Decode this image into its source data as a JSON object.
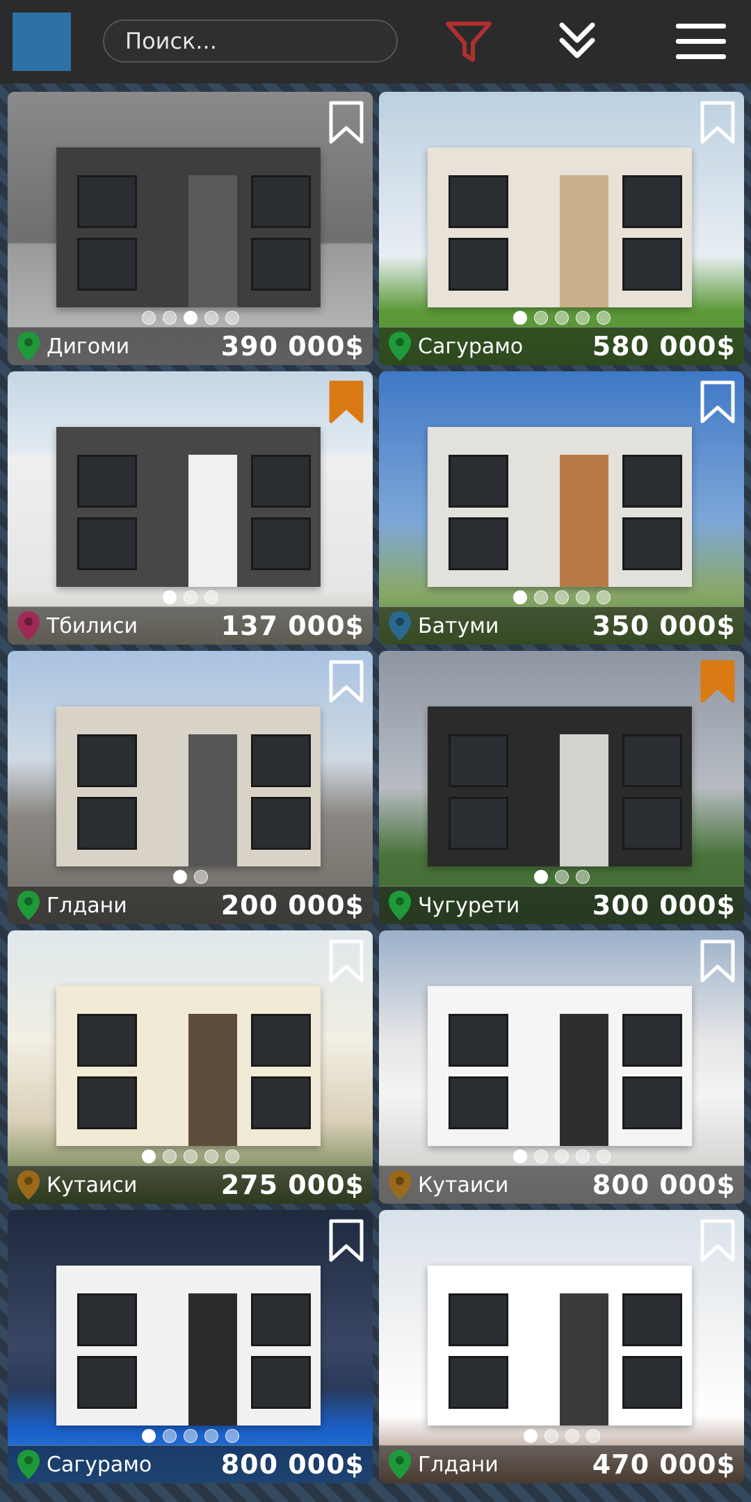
{
  "search": {
    "placeholder": "Поиск..."
  },
  "colors": {
    "accent_blue": "#2d72a6",
    "filter_red": "#b03030",
    "bookmark_saved": "#d97a12",
    "pin_green": "#1f9a3b",
    "pin_crimson": "#a02a56",
    "pin_blue": "#2a6a90",
    "pin_bronze": "#9a6a1a"
  },
  "icons": {
    "filter": "filter-icon",
    "collapse": "double-chevron-down-icon",
    "menu": "hamburger-menu-icon",
    "bookmark": "bookmark-icon",
    "location": "location-pin-icon"
  },
  "listings": [
    {
      "location": "Дигоми",
      "price": "390 000$",
      "saved": false,
      "pin": "green",
      "photos": 5,
      "active_photo": 3
    },
    {
      "location": "Сагурамо",
      "price": "580 000$",
      "saved": false,
      "pin": "green",
      "photos": 5,
      "active_photo": 1
    },
    {
      "location": "Тбилиси",
      "price": "137 000$",
      "saved": true,
      "pin": "crimson",
      "photos": 3,
      "active_photo": 1
    },
    {
      "location": "Батуми",
      "price": "350 000$",
      "saved": false,
      "pin": "blue",
      "photos": 5,
      "active_photo": 1
    },
    {
      "location": "Глдани",
      "price": "200 000$",
      "saved": false,
      "pin": "green",
      "photos": 2,
      "active_photo": 1
    },
    {
      "location": "Чугурети",
      "price": "300 000$",
      "saved": true,
      "pin": "green",
      "photos": 3,
      "active_photo": 1
    },
    {
      "location": "Кутаиси",
      "price": "275 000$",
      "saved": false,
      "pin": "bronze",
      "photos": 5,
      "active_photo": 1
    },
    {
      "location": "Кутаиси",
      "price": "800 000$",
      "saved": false,
      "pin": "bronze",
      "photos": 5,
      "active_photo": 1
    },
    {
      "location": "Сагурамо",
      "price": "800 000$",
      "saved": false,
      "pin": "green",
      "photos": 5,
      "active_photo": 1
    },
    {
      "location": "Глдани",
      "price": "470 000$",
      "saved": false,
      "pin": "green",
      "photos": 4,
      "active_photo": 1
    }
  ]
}
